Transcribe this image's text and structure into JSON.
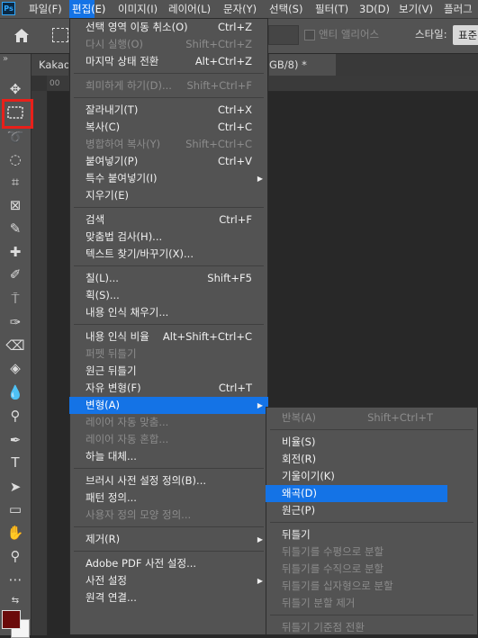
{
  "menubar": {
    "logo": "Ps",
    "items": [
      "파일(F)",
      "편집(E)",
      "이미지(I)",
      "레이어(L)",
      "문자(Y)",
      "선택(S)",
      "필터(T)",
      "3D(D)",
      "보기(V)",
      "플러그"
    ]
  },
  "options": {
    "anti_alias": "앤티 앨리어스",
    "style_label": "스타일:",
    "style_value": "표준"
  },
  "document": {
    "tab_left": "Kakao",
    "tab_right": "GB/8) *",
    "ruler_mark": "00"
  },
  "edit_menu": {
    "groups": [
      [
        {
          "label": "선택 영역 이동 취소(O)",
          "shortcut": "Ctrl+Z",
          "enabled": true
        },
        {
          "label": "다시 실행(O)",
          "shortcut": "Shift+Ctrl+Z",
          "enabled": false
        },
        {
          "label": "마지막 상태 전환",
          "shortcut": "Alt+Ctrl+Z",
          "enabled": true
        }
      ],
      [
        {
          "label": "희미하게 하기(D)...",
          "shortcut": "Shift+Ctrl+F",
          "enabled": false
        }
      ],
      [
        {
          "label": "잘라내기(T)",
          "shortcut": "Ctrl+X",
          "enabled": true
        },
        {
          "label": "복사(C)",
          "shortcut": "Ctrl+C",
          "enabled": true
        },
        {
          "label": "병합하여 복사(Y)",
          "shortcut": "Shift+Ctrl+C",
          "enabled": false
        },
        {
          "label": "붙여넣기(P)",
          "shortcut": "Ctrl+V",
          "enabled": true
        },
        {
          "label": "특수 붙여넣기(I)",
          "shortcut": "",
          "enabled": true,
          "submenu": true
        },
        {
          "label": "지우기(E)",
          "shortcut": "",
          "enabled": true
        }
      ],
      [
        {
          "label": "검색",
          "shortcut": "Ctrl+F",
          "enabled": true
        },
        {
          "label": "맞춤법 검사(H)...",
          "shortcut": "",
          "enabled": true
        },
        {
          "label": "텍스트 찾기/바꾸기(X)...",
          "shortcut": "",
          "enabled": true
        }
      ],
      [
        {
          "label": "칠(L)...",
          "shortcut": "Shift+F5",
          "enabled": true
        },
        {
          "label": "획(S)...",
          "shortcut": "",
          "enabled": true
        },
        {
          "label": "내용 인식 채우기...",
          "shortcut": "",
          "enabled": true
        }
      ],
      [
        {
          "label": "내용 인식 비율",
          "shortcut": "Alt+Shift+Ctrl+C",
          "enabled": true
        },
        {
          "label": "퍼펫 뒤틀기",
          "shortcut": "",
          "enabled": false
        },
        {
          "label": "원근 뒤틀기",
          "shortcut": "",
          "enabled": true
        },
        {
          "label": "자유 변형(F)",
          "shortcut": "Ctrl+T",
          "enabled": true
        },
        {
          "label": "변형(A)",
          "shortcut": "",
          "enabled": true,
          "submenu": true,
          "highlighted": true
        },
        {
          "label": "레이어 자동 맞춤...",
          "shortcut": "",
          "enabled": false
        },
        {
          "label": "레이어 자동 혼합...",
          "shortcut": "",
          "enabled": false
        },
        {
          "label": "하늘 대체...",
          "shortcut": "",
          "enabled": true
        }
      ],
      [
        {
          "label": "브러시 사전 설정 정의(B)...",
          "shortcut": "",
          "enabled": true
        },
        {
          "label": "패턴 정의...",
          "shortcut": "",
          "enabled": true
        },
        {
          "label": "사용자 정의 모양 정의...",
          "shortcut": "",
          "enabled": false
        }
      ],
      [
        {
          "label": "제거(R)",
          "shortcut": "",
          "enabled": true,
          "submenu": true
        }
      ],
      [
        {
          "label": "Adobe PDF 사전 설정...",
          "shortcut": "",
          "enabled": true
        },
        {
          "label": "사전 설정",
          "shortcut": "",
          "enabled": true,
          "submenu": true
        },
        {
          "label": "원격 연결...",
          "shortcut": "",
          "enabled": true
        }
      ]
    ]
  },
  "transform_menu": {
    "groups": [
      [
        {
          "label": "반복(A)",
          "shortcut": "Shift+Ctrl+T",
          "enabled": false
        }
      ],
      [
        {
          "label": "비율(S)",
          "enabled": true
        },
        {
          "label": "회전(R)",
          "enabled": true
        },
        {
          "label": "기울이기(K)",
          "enabled": true
        },
        {
          "label": "왜곡(D)",
          "enabled": true,
          "highlighted": true
        },
        {
          "label": "원근(P)",
          "enabled": true
        }
      ],
      [
        {
          "label": "뒤틀기",
          "enabled": true
        },
        {
          "label": "뒤틀기를 수평으로 분할",
          "enabled": false
        },
        {
          "label": "뒤틀기를 수직으로 분할",
          "enabled": false
        },
        {
          "label": "뒤틀기를 십자형으로 분할",
          "enabled": false
        },
        {
          "label": "뒤틀기 분할 제거",
          "enabled": false
        }
      ],
      [
        {
          "label": "뒤틀기 기준점 전환",
          "enabled": false
        }
      ]
    ]
  },
  "colors": {
    "accent": "#1473e6",
    "highlight_box": "#e8201a",
    "foreground": "#6b0b0b",
    "background": "#f5f5f5"
  }
}
